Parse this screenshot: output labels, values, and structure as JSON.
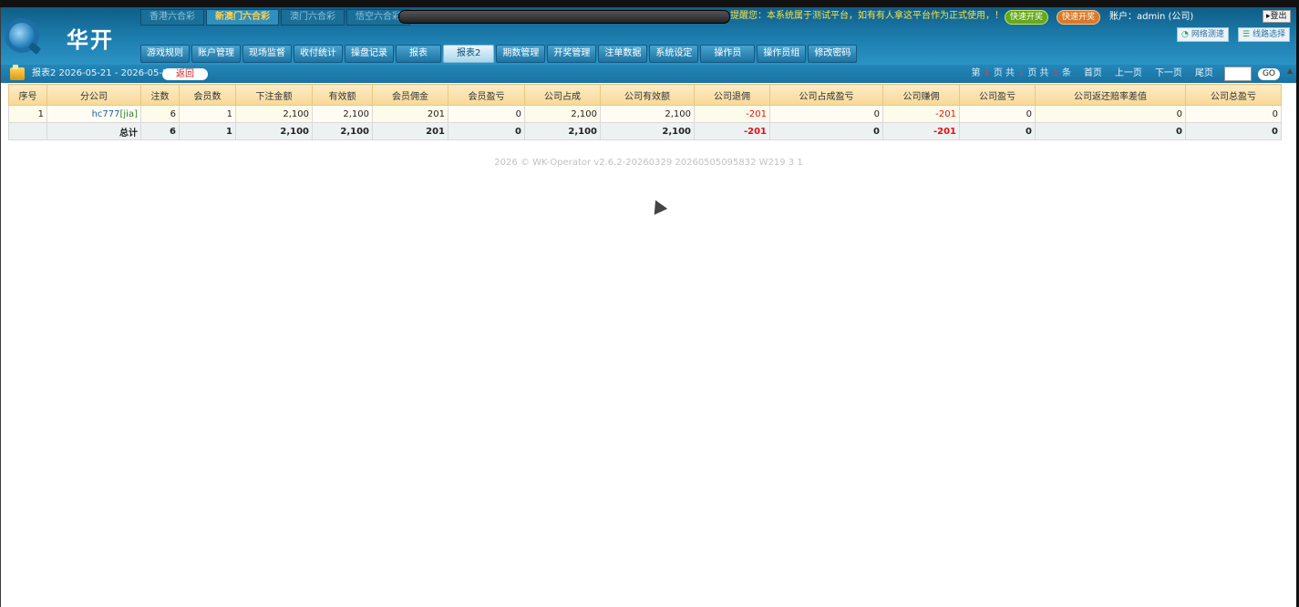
{
  "brand": {
    "name": "华开"
  },
  "lottery_tabs": [
    {
      "label": "香港六合彩",
      "active": false
    },
    {
      "label": "新澳门六合彩",
      "active": true
    },
    {
      "label": "澳门六合彩",
      "active": false
    },
    {
      "label": "悟空六合彩",
      "active": false
    }
  ],
  "notice": {
    "text": "提醒您：本系统属于测试平台，如有有人拿这平台作为正式使用，！"
  },
  "quick_buttons": {
    "green": "快速开奖",
    "orange": "快速开奖"
  },
  "account": {
    "text": "账户：admin (公司)"
  },
  "logout": {
    "label": "登出"
  },
  "tools": {
    "speed_test": "网络测速",
    "line_select": "线路选择"
  },
  "nav": [
    {
      "label": "游戏规则"
    },
    {
      "label": "账户管理"
    },
    {
      "label": "现场监督"
    },
    {
      "label": "收付统计"
    },
    {
      "label": "操盘记录"
    },
    {
      "label": "报表"
    },
    {
      "label": "报表2"
    },
    {
      "label": "期数管理"
    },
    {
      "label": "开奖管理"
    },
    {
      "label": "注单数据"
    },
    {
      "label": "系统设定"
    },
    {
      "label": "操作员"
    },
    {
      "label": "操作员组"
    },
    {
      "label": "修改密码"
    }
  ],
  "subbar": {
    "title": "报表2 2026-05-21 - 2026-05-24",
    "back": "返回"
  },
  "pager": {
    "page_prefix": "第",
    "page": "1",
    "page_unit": "页 共",
    "total_pages": "1",
    "pages_unit": "页 共",
    "total_items": "1",
    "items_unit": "条",
    "first": "首页",
    "prev": "上一页",
    "next": "下一页",
    "last": "尾页",
    "go": "GO"
  },
  "table": {
    "headers": [
      "序号",
      "分公司",
      "注数",
      "会员数",
      "下注金额",
      "有效额",
      "会员佣金",
      "会员盈亏",
      "公司占成",
      "公司有效额",
      "公司退佣",
      "公司占成盈亏",
      "公司赚佣",
      "公司盈亏",
      "公司返还赔率差值",
      "公司总盈亏"
    ],
    "row": {
      "index": "1",
      "company": "hc777",
      "company_tag": "[jia]",
      "bets": "6",
      "members": "1",
      "amount": "2,100",
      "valid": "2,100",
      "member_comm": "201",
      "member_pl": "0",
      "company_share": "2,100",
      "company_valid": "2,100",
      "company_rebate": "-201",
      "company_share_pl": "0",
      "company_comm": "-201",
      "company_pl": "0",
      "odds_diff": "0",
      "company_total_pl": "0"
    },
    "total": {
      "label": "总计",
      "bets": "6",
      "members": "1",
      "amount": "2,100",
      "valid": "2,100",
      "member_comm": "201",
      "member_pl": "0",
      "company_share": "2,100",
      "company_valid": "2,100",
      "company_rebate": "-201",
      "company_share_pl": "0",
      "company_comm": "-201",
      "company_pl": "0",
      "odds_diff": "0",
      "company_total_pl": "0"
    }
  },
  "footer": {
    "text": "2026 © WK-Operator v2.6.2-20260329 20260505095832 W219 3 1"
  },
  "colors": {
    "header": "#1d7fb0",
    "table_head": "#f7d897",
    "negative": "#e01010"
  }
}
